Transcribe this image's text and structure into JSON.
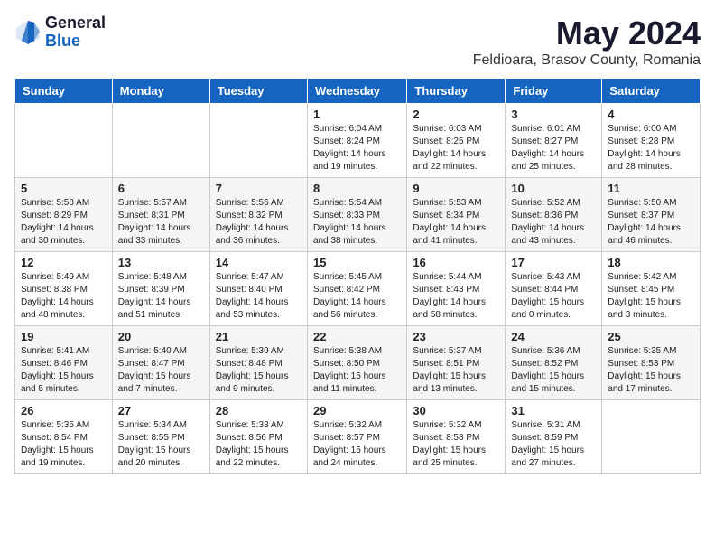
{
  "header": {
    "logo_general": "General",
    "logo_blue": "Blue",
    "month_title": "May 2024",
    "location": "Feldioara, Brasov County, Romania"
  },
  "days_of_week": [
    "Sunday",
    "Monday",
    "Tuesday",
    "Wednesday",
    "Thursday",
    "Friday",
    "Saturday"
  ],
  "weeks": [
    [
      {
        "day": "",
        "sunrise": "",
        "sunset": "",
        "daylight": ""
      },
      {
        "day": "",
        "sunrise": "",
        "sunset": "",
        "daylight": ""
      },
      {
        "day": "",
        "sunrise": "",
        "sunset": "",
        "daylight": ""
      },
      {
        "day": "1",
        "sunrise": "Sunrise: 6:04 AM",
        "sunset": "Sunset: 8:24 PM",
        "daylight": "Daylight: 14 hours and 19 minutes."
      },
      {
        "day": "2",
        "sunrise": "Sunrise: 6:03 AM",
        "sunset": "Sunset: 8:25 PM",
        "daylight": "Daylight: 14 hours and 22 minutes."
      },
      {
        "day": "3",
        "sunrise": "Sunrise: 6:01 AM",
        "sunset": "Sunset: 8:27 PM",
        "daylight": "Daylight: 14 hours and 25 minutes."
      },
      {
        "day": "4",
        "sunrise": "Sunrise: 6:00 AM",
        "sunset": "Sunset: 8:28 PM",
        "daylight": "Daylight: 14 hours and 28 minutes."
      }
    ],
    [
      {
        "day": "5",
        "sunrise": "Sunrise: 5:58 AM",
        "sunset": "Sunset: 8:29 PM",
        "daylight": "Daylight: 14 hours and 30 minutes."
      },
      {
        "day": "6",
        "sunrise": "Sunrise: 5:57 AM",
        "sunset": "Sunset: 8:31 PM",
        "daylight": "Daylight: 14 hours and 33 minutes."
      },
      {
        "day": "7",
        "sunrise": "Sunrise: 5:56 AM",
        "sunset": "Sunset: 8:32 PM",
        "daylight": "Daylight: 14 hours and 36 minutes."
      },
      {
        "day": "8",
        "sunrise": "Sunrise: 5:54 AM",
        "sunset": "Sunset: 8:33 PM",
        "daylight": "Daylight: 14 hours and 38 minutes."
      },
      {
        "day": "9",
        "sunrise": "Sunrise: 5:53 AM",
        "sunset": "Sunset: 8:34 PM",
        "daylight": "Daylight: 14 hours and 41 minutes."
      },
      {
        "day": "10",
        "sunrise": "Sunrise: 5:52 AM",
        "sunset": "Sunset: 8:36 PM",
        "daylight": "Daylight: 14 hours and 43 minutes."
      },
      {
        "day": "11",
        "sunrise": "Sunrise: 5:50 AM",
        "sunset": "Sunset: 8:37 PM",
        "daylight": "Daylight: 14 hours and 46 minutes."
      }
    ],
    [
      {
        "day": "12",
        "sunrise": "Sunrise: 5:49 AM",
        "sunset": "Sunset: 8:38 PM",
        "daylight": "Daylight: 14 hours and 48 minutes."
      },
      {
        "day": "13",
        "sunrise": "Sunrise: 5:48 AM",
        "sunset": "Sunset: 8:39 PM",
        "daylight": "Daylight: 14 hours and 51 minutes."
      },
      {
        "day": "14",
        "sunrise": "Sunrise: 5:47 AM",
        "sunset": "Sunset: 8:40 PM",
        "daylight": "Daylight: 14 hours and 53 minutes."
      },
      {
        "day": "15",
        "sunrise": "Sunrise: 5:45 AM",
        "sunset": "Sunset: 8:42 PM",
        "daylight": "Daylight: 14 hours and 56 minutes."
      },
      {
        "day": "16",
        "sunrise": "Sunrise: 5:44 AM",
        "sunset": "Sunset: 8:43 PM",
        "daylight": "Daylight: 14 hours and 58 minutes."
      },
      {
        "day": "17",
        "sunrise": "Sunrise: 5:43 AM",
        "sunset": "Sunset: 8:44 PM",
        "daylight": "Daylight: 15 hours and 0 minutes."
      },
      {
        "day": "18",
        "sunrise": "Sunrise: 5:42 AM",
        "sunset": "Sunset: 8:45 PM",
        "daylight": "Daylight: 15 hours and 3 minutes."
      }
    ],
    [
      {
        "day": "19",
        "sunrise": "Sunrise: 5:41 AM",
        "sunset": "Sunset: 8:46 PM",
        "daylight": "Daylight: 15 hours and 5 minutes."
      },
      {
        "day": "20",
        "sunrise": "Sunrise: 5:40 AM",
        "sunset": "Sunset: 8:47 PM",
        "daylight": "Daylight: 15 hours and 7 minutes."
      },
      {
        "day": "21",
        "sunrise": "Sunrise: 5:39 AM",
        "sunset": "Sunset: 8:48 PM",
        "daylight": "Daylight: 15 hours and 9 minutes."
      },
      {
        "day": "22",
        "sunrise": "Sunrise: 5:38 AM",
        "sunset": "Sunset: 8:50 PM",
        "daylight": "Daylight: 15 hours and 11 minutes."
      },
      {
        "day": "23",
        "sunrise": "Sunrise: 5:37 AM",
        "sunset": "Sunset: 8:51 PM",
        "daylight": "Daylight: 15 hours and 13 minutes."
      },
      {
        "day": "24",
        "sunrise": "Sunrise: 5:36 AM",
        "sunset": "Sunset: 8:52 PM",
        "daylight": "Daylight: 15 hours and 15 minutes."
      },
      {
        "day": "25",
        "sunrise": "Sunrise: 5:35 AM",
        "sunset": "Sunset: 8:53 PM",
        "daylight": "Daylight: 15 hours and 17 minutes."
      }
    ],
    [
      {
        "day": "26",
        "sunrise": "Sunrise: 5:35 AM",
        "sunset": "Sunset: 8:54 PM",
        "daylight": "Daylight: 15 hours and 19 minutes."
      },
      {
        "day": "27",
        "sunrise": "Sunrise: 5:34 AM",
        "sunset": "Sunset: 8:55 PM",
        "daylight": "Daylight: 15 hours and 20 minutes."
      },
      {
        "day": "28",
        "sunrise": "Sunrise: 5:33 AM",
        "sunset": "Sunset: 8:56 PM",
        "daylight": "Daylight: 15 hours and 22 minutes."
      },
      {
        "day": "29",
        "sunrise": "Sunrise: 5:32 AM",
        "sunset": "Sunset: 8:57 PM",
        "daylight": "Daylight: 15 hours and 24 minutes."
      },
      {
        "day": "30",
        "sunrise": "Sunrise: 5:32 AM",
        "sunset": "Sunset: 8:58 PM",
        "daylight": "Daylight: 15 hours and 25 minutes."
      },
      {
        "day": "31",
        "sunrise": "Sunrise: 5:31 AM",
        "sunset": "Sunset: 8:59 PM",
        "daylight": "Daylight: 15 hours and 27 minutes."
      },
      {
        "day": "",
        "sunrise": "",
        "sunset": "",
        "daylight": ""
      }
    ]
  ]
}
